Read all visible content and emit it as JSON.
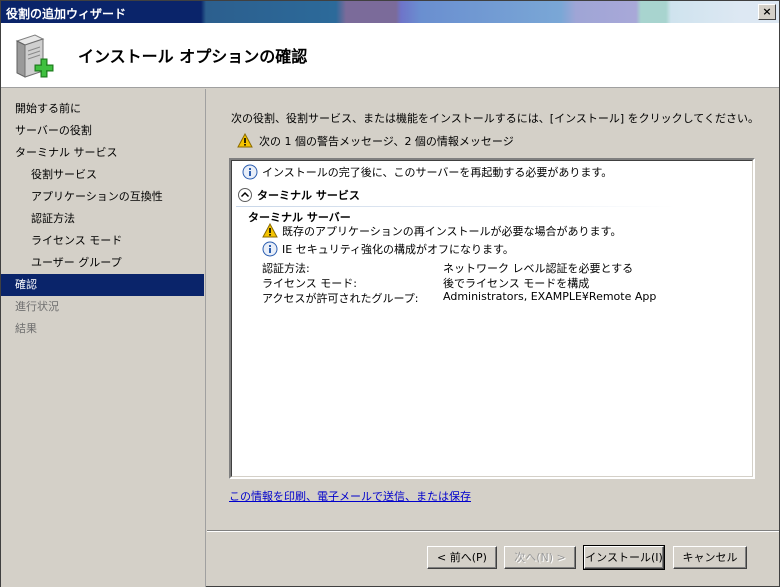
{
  "window": {
    "title": "役割の追加ウィザード",
    "close_glyph": "×"
  },
  "header": {
    "title": "インストール オプションの確認",
    "icon": "server-add-icon"
  },
  "nav": {
    "items": [
      {
        "label": "開始する前に",
        "level": 0,
        "state": "normal"
      },
      {
        "label": "サーバーの役割",
        "level": 0,
        "state": "normal"
      },
      {
        "label": "ターミナル サービス",
        "level": 0,
        "state": "normal"
      },
      {
        "label": "役割サービス",
        "level": 1,
        "state": "normal"
      },
      {
        "label": "アプリケーションの互換性",
        "level": 1,
        "state": "normal"
      },
      {
        "label": "認証方法",
        "level": 1,
        "state": "normal"
      },
      {
        "label": "ライセンス モード",
        "level": 1,
        "state": "normal"
      },
      {
        "label": "ユーザー グループ",
        "level": 1,
        "state": "normal"
      },
      {
        "label": "確認",
        "level": 0,
        "state": "active"
      },
      {
        "label": "進行状況",
        "level": 0,
        "state": "disabled"
      },
      {
        "label": "結果",
        "level": 0,
        "state": "disabled"
      }
    ]
  },
  "main": {
    "instruction": "次の役割、役割サービス、または機能をインストールするには、[インストール] をクリックしてください。",
    "warning_summary": "次の 1 個の警告メッセージ、2 個の情報メッセージ",
    "details": {
      "restart_info": "インストールの完了後に、このサーバーを再起動する必要があります。",
      "section_title": "ターミナル サービス",
      "subsection_title": "ターミナル サーバー",
      "warning": "既存のアプリケーションの再インストールが必要な場合があります。",
      "info": "IE セキュリティ強化の構成がオフになります。",
      "settings": [
        {
          "key": "認証方法:",
          "value": "ネットワーク レベル認証を必要とする"
        },
        {
          "key": "ライセンス モード:",
          "value": "後でライセンス モードを構成"
        },
        {
          "key": "アクセスが許可されたグループ:",
          "value": "Administrators, EXAMPLE¥Remote App"
        }
      ]
    },
    "print_link": "この情報を印刷、電子メールで送信、または保存"
  },
  "buttons": {
    "back": "< 前へ(P)",
    "next": "次へ(N) >",
    "install": "インストール(I)",
    "cancel": "キャンセル"
  },
  "colors": {
    "selection": "#0a246a",
    "link": "#0000cc",
    "warning": "#f5c400",
    "info": "#2a5db0"
  }
}
